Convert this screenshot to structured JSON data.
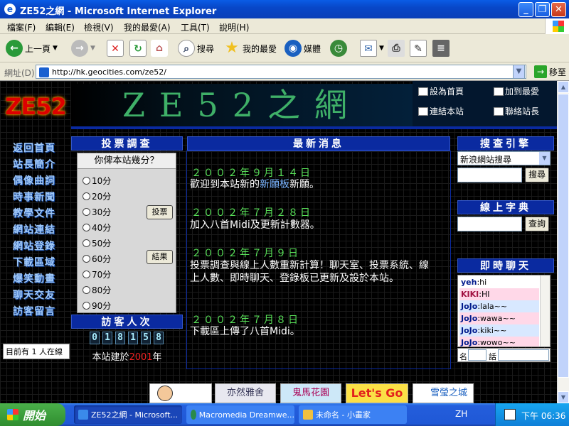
{
  "window": {
    "title": "ZE52之網 - Microsoft Internet Explorer",
    "icon": "ie-icon"
  },
  "menu": [
    "檔案(F)",
    "編輯(E)",
    "檢視(V)",
    "我的最愛(A)",
    "工具(T)",
    "說明(H)"
  ],
  "toolbar": {
    "back": "上一頁",
    "search": "搜尋",
    "favorites": "我的最愛",
    "media": "媒體"
  },
  "address": {
    "label": "網址(D)",
    "url": "http://hk.geocities.com/ze52/",
    "go": "移至"
  },
  "site": {
    "logo": "ZE52",
    "banner": "ZE52之網",
    "links": {
      "home": "設為首頁",
      "fav": "加到最愛",
      "link": "連結本站",
      "contact": "聯絡站長"
    },
    "nav": [
      "返回首頁",
      "站長簡介",
      "偶像曲詞",
      "時事新聞",
      "教學文件",
      "網站連結",
      "網站登錄",
      "下載區域",
      "爆笑動畫",
      "聊天交友",
      "訪客留言"
    ],
    "poll": {
      "title": "投票調查",
      "question": "你俾本站幾分？",
      "options": [
        "10分",
        "20分",
        "30分",
        "40分",
        "50分",
        "60分",
        "70分",
        "80分",
        "90分"
      ],
      "vote": "投票",
      "results": "結果"
    },
    "visitors": {
      "title": "訪客人次",
      "count": "018158",
      "since_prefix": "本站建於",
      "since_year": "2001",
      "since_suffix": "年"
    },
    "online": "目前有 1 人在線",
    "news": {
      "title": "最新消息",
      "items": [
        {
          "date": "２００２年９月１４日",
          "text_a": "歡迎到本站新的",
          "link": "新願板",
          "text_b": "新願。"
        },
        {
          "date": "２００２年７月２８日",
          "text": "加入八首Midi及更新計數器。"
        },
        {
          "date": "２００２年７月９日",
          "text": "投票調查與線上人數重新計算！聊天室、投票系統、線上人數、即時聊天、登錄板已更新及設於本站。"
        },
        {
          "date": "２００２年７月８日",
          "text": "下載區上傳了八首Midi。"
        }
      ]
    },
    "search": {
      "title": "搜查引擎",
      "engine": "新浪網站搜尋",
      "button": "搜尋"
    },
    "dict": {
      "title": "線上字典",
      "button": "查詢"
    },
    "chat": {
      "title": "即時聊天",
      "messages": [
        {
          "user": "yeh",
          "msg": ":hi"
        },
        {
          "user": "KIKI",
          "msg": ":HI"
        },
        {
          "user": "JoJo",
          "msg": ":lala~~"
        },
        {
          "user": "JoJo",
          "msg": ":wawa~~"
        },
        {
          "user": "JoJo",
          "msg": ":kiki~~"
        },
        {
          "user": "JoJo",
          "msg": ":wowo~~"
        }
      ],
      "name_label": "名",
      "talk_label": "話"
    },
    "bottom_banners": [
      "",
      "亦然雅舍",
      "鬼馬花園",
      "Let's Go !!",
      "雪瑩之城"
    ]
  },
  "taskbar": {
    "start": "開始",
    "tasks": [
      "ZE52之網 - Microsoft...",
      "Macromedia Dreamwe...",
      "未命名 - 小畫家"
    ],
    "lang": "ZH",
    "clock": "下午 06:36"
  },
  "colors": {
    "accent": "#0a2aa0",
    "news_date": "#58e058",
    "xp_blue": "#245edc"
  }
}
